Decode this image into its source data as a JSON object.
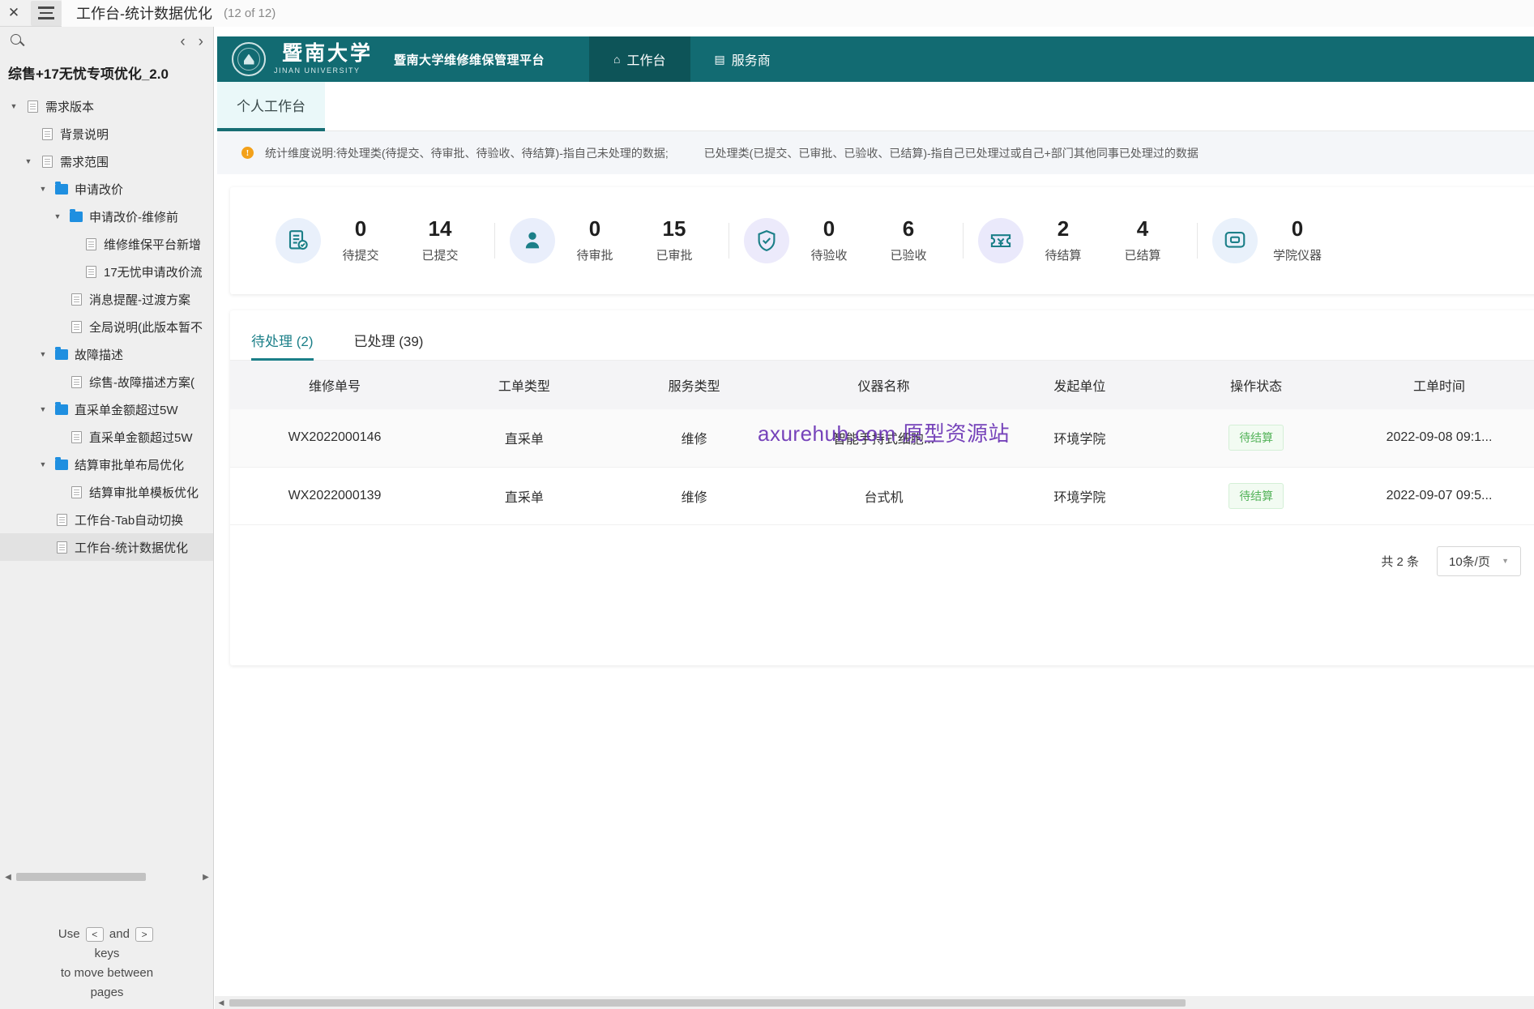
{
  "topbar": {
    "close_icon": "close-icon",
    "menu_icon": "hamburger-icon",
    "title": "工作台-统计数据优化",
    "page_count": "(12 of 12)"
  },
  "sidebar": {
    "search_icon": "search-icon",
    "prev_label": "‹",
    "next_label": "›",
    "project_title": "综售+17无忧专项优化_2.0",
    "tree": [
      {
        "label": "需求版本",
        "depth": 0,
        "type": "page",
        "expanded": true,
        "selected": false
      },
      {
        "label": "背景说明",
        "depth": 1,
        "type": "page",
        "expanded": null,
        "selected": false
      },
      {
        "label": "需求范围",
        "depth": 1,
        "type": "page",
        "expanded": true,
        "selected": false
      },
      {
        "label": "申请改价",
        "depth": 2,
        "type": "folder",
        "expanded": true,
        "selected": false
      },
      {
        "label": "申请改价-维修前",
        "depth": 3,
        "type": "folder",
        "expanded": true,
        "selected": false
      },
      {
        "label": "维修维保平台新增",
        "depth": 4,
        "type": "page",
        "expanded": null,
        "selected": false
      },
      {
        "label": "17无忧申请改价流",
        "depth": 4,
        "type": "page",
        "expanded": null,
        "selected": false
      },
      {
        "label": "消息提醒-过渡方案",
        "depth": 3,
        "type": "page",
        "expanded": null,
        "selected": false
      },
      {
        "label": "全局说明(此版本暂不",
        "depth": 3,
        "type": "page",
        "expanded": null,
        "selected": false
      },
      {
        "label": "故障描述",
        "depth": 2,
        "type": "folder",
        "expanded": true,
        "selected": false
      },
      {
        "label": "综售-故障描述方案(",
        "depth": 3,
        "type": "page",
        "expanded": null,
        "selected": false
      },
      {
        "label": "直采单金额超过5W",
        "depth": 2,
        "type": "folder",
        "expanded": true,
        "selected": false
      },
      {
        "label": "直采单金额超过5W",
        "depth": 3,
        "type": "page",
        "expanded": null,
        "selected": false
      },
      {
        "label": "结算审批单布局优化",
        "depth": 2,
        "type": "folder",
        "expanded": true,
        "selected": false
      },
      {
        "label": "结算审批单模板优化",
        "depth": 3,
        "type": "page",
        "expanded": null,
        "selected": false
      },
      {
        "label": "工作台-Tab自动切换",
        "depth": 2,
        "type": "page",
        "expanded": null,
        "selected": false
      },
      {
        "label": "工作台-统计数据优化",
        "depth": 2,
        "type": "page",
        "expanded": null,
        "selected": true
      }
    ],
    "help": {
      "line1": "Use",
      "key_prev": "<",
      "and": "and",
      "key_next": ">",
      "line2": "keys",
      "line3": "to move between",
      "line4": "pages"
    }
  },
  "header": {
    "brand_cn": "暨南大学",
    "brand_en": "JINAN UNIVERSITY",
    "platform_name": "暨南大学维修维保管理平台",
    "logo_icon": "university-crest-icon",
    "nav": [
      {
        "label": "工作台",
        "icon": "home-icon",
        "active": true
      },
      {
        "label": "服务商",
        "icon": "shop-icon",
        "active": false
      }
    ],
    "bg_color": "#126b72",
    "active_bg_color": "#0d5458"
  },
  "subtab": {
    "label": "个人工作台",
    "accent_color": "#176e74"
  },
  "alert": {
    "icon": "info-icon",
    "icon_color": "#f3a11a",
    "text_part1": "统计维度说明:待处理类(待提交、待审批、待验收、待结算)-指自己未处理的数据;",
    "text_part2": "已处理类(已提交、已审批、已验收、已结算)-指自己已处理过或自己+部门其他同事已处理过的数据"
  },
  "stats": [
    {
      "icon": "document-check-icon",
      "icon_bg": "#e9f0fb",
      "items": [
        {
          "value": "0",
          "label": "待提交"
        },
        {
          "value": "14",
          "label": "已提交"
        }
      ]
    },
    {
      "icon": "person-stamp-icon",
      "icon_bg": "#e9eefb",
      "items": [
        {
          "value": "0",
          "label": "待审批"
        },
        {
          "value": "15",
          "label": "已审批"
        }
      ]
    },
    {
      "icon": "shield-check-icon",
      "icon_bg": "#eceafb",
      "items": [
        {
          "value": "0",
          "label": "待验收"
        },
        {
          "value": "6",
          "label": "已验收"
        }
      ]
    },
    {
      "icon": "yuan-money-icon",
      "icon_bg": "#eae9fb",
      "items": [
        {
          "value": "2",
          "label": "待结算"
        },
        {
          "value": "4",
          "label": "已结算"
        }
      ]
    },
    {
      "icon": "instrument-icon",
      "icon_bg": "#e9f1fb",
      "items": [
        {
          "value": "0",
          "label": "学院仪器"
        }
      ]
    }
  ],
  "tabs": [
    {
      "label": "待处理 (2)",
      "active": true
    },
    {
      "label": "已处理 (39)",
      "active": false
    }
  ],
  "watermark": "axurehub.com 原型资源站",
  "table": {
    "columns": [
      "维修单号",
      "工单类型",
      "服务类型",
      "仪器名称",
      "发起单位",
      "操作状态",
      "工单时间"
    ],
    "rows": [
      {
        "order_no": "WX2022000146",
        "order_type": "直采单",
        "service_type": "维修",
        "instrument": "智能手持式细胞...",
        "unit": "环境学院",
        "status": "待结算",
        "time": "2022-09-08 09:1..."
      },
      {
        "order_no": "WX2022000139",
        "order_type": "直采单",
        "service_type": "维修",
        "instrument": "台式机",
        "unit": "环境学院",
        "status": "待结算",
        "time": "2022-09-07 09:5..."
      }
    ],
    "footer": {
      "total": "共 2 条",
      "page_size": "10条/页",
      "chevron_icon": "chevron-down-icon"
    },
    "status_color": "#54b35a"
  }
}
